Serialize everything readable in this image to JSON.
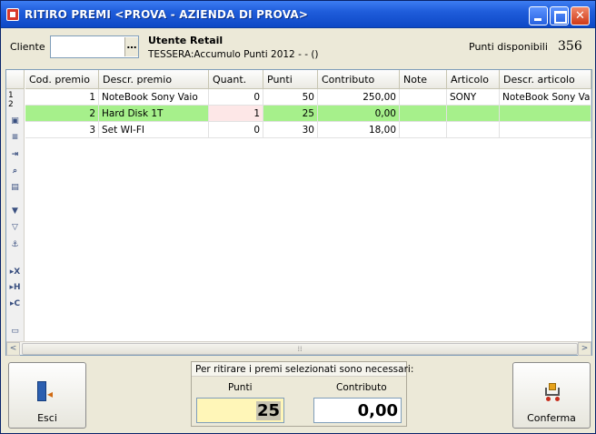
{
  "window": {
    "title": "RITIRO PREMI <PROVA - AZIENDA DI PROVA>",
    "min_label": "",
    "max_label": "",
    "close_label": "✕"
  },
  "header": {
    "cliente_label": "Cliente",
    "cliente_value": "",
    "cliente_button": "…",
    "user_name": "Utente Retail",
    "tessera": "TESSERA:Accumulo Punti 2012 -  - ()",
    "punti_disponibili_label": "Punti disponibili",
    "punti_disponibili_value": "356"
  },
  "grid": {
    "columns": [
      "Cod. premio",
      "Descr. premio",
      "Quant.",
      "Punti",
      "Contributo",
      "Note",
      "Articolo",
      "Descr. articolo"
    ],
    "row_numbers": [
      "1",
      "2"
    ],
    "rows": [
      {
        "cod": "1",
        "descr": "NoteBook Sony Vaio",
        "quant": "0",
        "punti": "50",
        "contributo": "250,00",
        "note": "",
        "articolo": "SONY",
        "descr_articolo": "NoteBook Sony Vaio"
      },
      {
        "cod": "2",
        "descr": "Hard Disk 1T",
        "quant": "1",
        "punti": "25",
        "contributo": "0,00",
        "note": "",
        "articolo": "",
        "descr_articolo": ""
      },
      {
        "cod": "3",
        "descr": "Set WI-FI",
        "quant": "0",
        "punti": "30",
        "contributo": "18,00",
        "note": "",
        "articolo": "",
        "descr_articolo": ""
      }
    ],
    "selected_row_color": "#a6f08b",
    "side_icons": [
      "copy-icon",
      "list-icon",
      "import-icon",
      "zoom-icon",
      "columns-icon",
      "filter-icon",
      "filter-clear-icon",
      "anchor-icon",
      "export-x-icon",
      "export-h-icon",
      "export-c-icon",
      "terminal-icon"
    ],
    "scroll_left": "<",
    "scroll_right": ">",
    "scroll_grip": "⁞⁞"
  },
  "footer": {
    "exit_label": "Esci",
    "confirm_label": "Conferma",
    "summary_caption": "Per ritirare i premi selezionati sono necessari:",
    "punti_label": "Punti",
    "punti_value": "25",
    "contributo_label": "Contributo",
    "contributo_value": "0,00"
  }
}
